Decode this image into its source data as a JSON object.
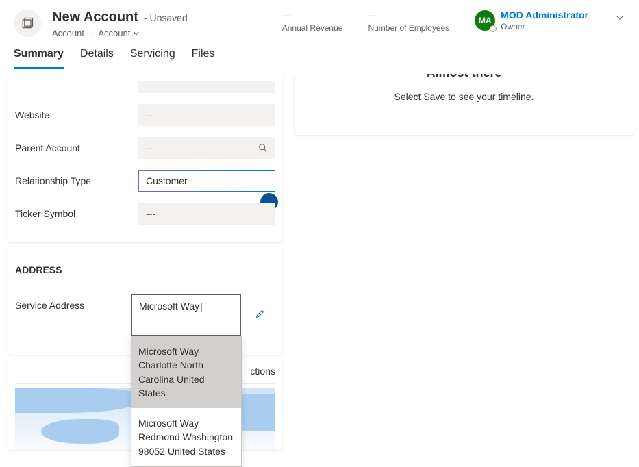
{
  "header": {
    "title": "New Account",
    "status": "- Unsaved",
    "entity_label": "Account",
    "form_selector": "Account"
  },
  "header_fields": {
    "annual_revenue": {
      "value": "---",
      "label": "Annual Revenue"
    },
    "num_employees": {
      "value": "---",
      "label": "Number of Employees"
    },
    "owner": {
      "initials": "MA",
      "name": "MOD Administrator",
      "label": "Owner"
    }
  },
  "tabs": [
    "Summary",
    "Details",
    "Servicing",
    "Files"
  ],
  "active_tab": "Summary",
  "fields": {
    "website": {
      "label": "Website",
      "value": "---"
    },
    "parent_account": {
      "label": "Parent Account",
      "value": "---"
    },
    "relationship_type": {
      "label": "Relationship Type",
      "value": "Customer"
    },
    "ticker_symbol": {
      "label": "Ticker Symbol",
      "value": "---"
    }
  },
  "address_section": {
    "title": "ADDRESS",
    "service_address": {
      "label": "Service Address",
      "input_value": "Microsoft Way",
      "suggestions": [
        "Microsoft Way Charlotte North Carolina United States",
        "Microsoft Way Redmond Washington 98052 United States"
      ]
    }
  },
  "map_section": {
    "tabs_suffix": "ctions"
  },
  "timeline": {
    "title": "Almost there",
    "subtitle": "Select Save to see your timeline."
  }
}
